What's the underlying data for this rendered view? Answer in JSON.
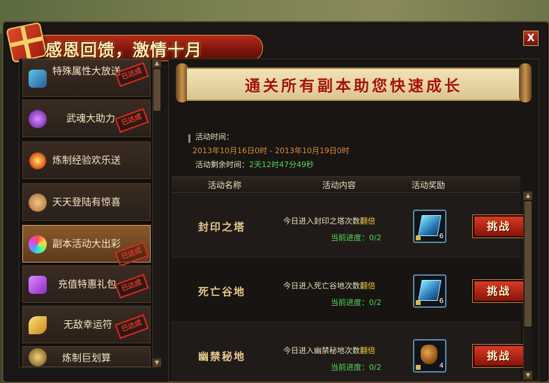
{
  "window": {
    "title": "感恩回馈，激情十月",
    "close_label": "X"
  },
  "sidebar": {
    "items": [
      {
        "label": "特殊属性大放送",
        "stamp": "已达成",
        "icon": "gift-box-icon",
        "active": false
      },
      {
        "label": "武魂大助力",
        "stamp": "已达成",
        "icon": "purple-orb-icon",
        "active": false
      },
      {
        "label": "炼制经验欢乐送",
        "stamp": "",
        "icon": "star-burst-icon",
        "active": false
      },
      {
        "label": "天天登陆有惊喜",
        "stamp": "",
        "icon": "paw-icon",
        "active": false
      },
      {
        "label": "副本活动大出彩",
        "stamp": "已达成",
        "icon": "fireworks-icon",
        "active": true
      },
      {
        "label": "充值特惠礼包",
        "stamp": "已达成",
        "icon": "gift-package-icon",
        "active": false
      },
      {
        "label": "无敌幸运符",
        "stamp": "已达成",
        "icon": "talisman-icon",
        "active": false
      },
      {
        "label": "炼制巨划算",
        "stamp": "",
        "icon": "furnace-icon",
        "active": false
      }
    ]
  },
  "banner": {
    "text": "通关所有副本助您快速成长"
  },
  "info": {
    "time_label": "活动时间：",
    "time_range": "2013年10月16日0时 - 2013年10月19日0时",
    "remain_label": "活动剩余时间：",
    "remain_value": "2天12时47分49秒"
  },
  "table": {
    "headers": [
      "活动名称",
      "活动内容",
      "活动奖励"
    ],
    "rows": [
      {
        "name": "封印之塔",
        "desc_prefix": "今日进入封印之塔次数",
        "desc_hl": "翻倍",
        "progress": "当前进度：0/2",
        "reward_icon": "scroll-icon",
        "reward_count": "6",
        "action": "挑战"
      },
      {
        "name": "死亡谷地",
        "desc_prefix": "今日进入死亡谷地次数",
        "desc_hl": "翻倍",
        "progress": "当前进度：0/2",
        "reward_icon": "scroll-icon",
        "reward_count": "6",
        "action": "挑战"
      },
      {
        "name": "幽禁秘地",
        "desc_prefix": "今日进入幽禁秘地次数",
        "desc_hl": "翻倍",
        "progress": "当前进度：0/2",
        "reward_icon": "potion-bag-icon",
        "reward_count": "4",
        "action": "挑战"
      }
    ]
  },
  "colors": {
    "accent_red": "#a3120a",
    "date_orange": "#e08a3c",
    "progress_green": "#54d858",
    "highlight_yellow": "#f0d040"
  }
}
